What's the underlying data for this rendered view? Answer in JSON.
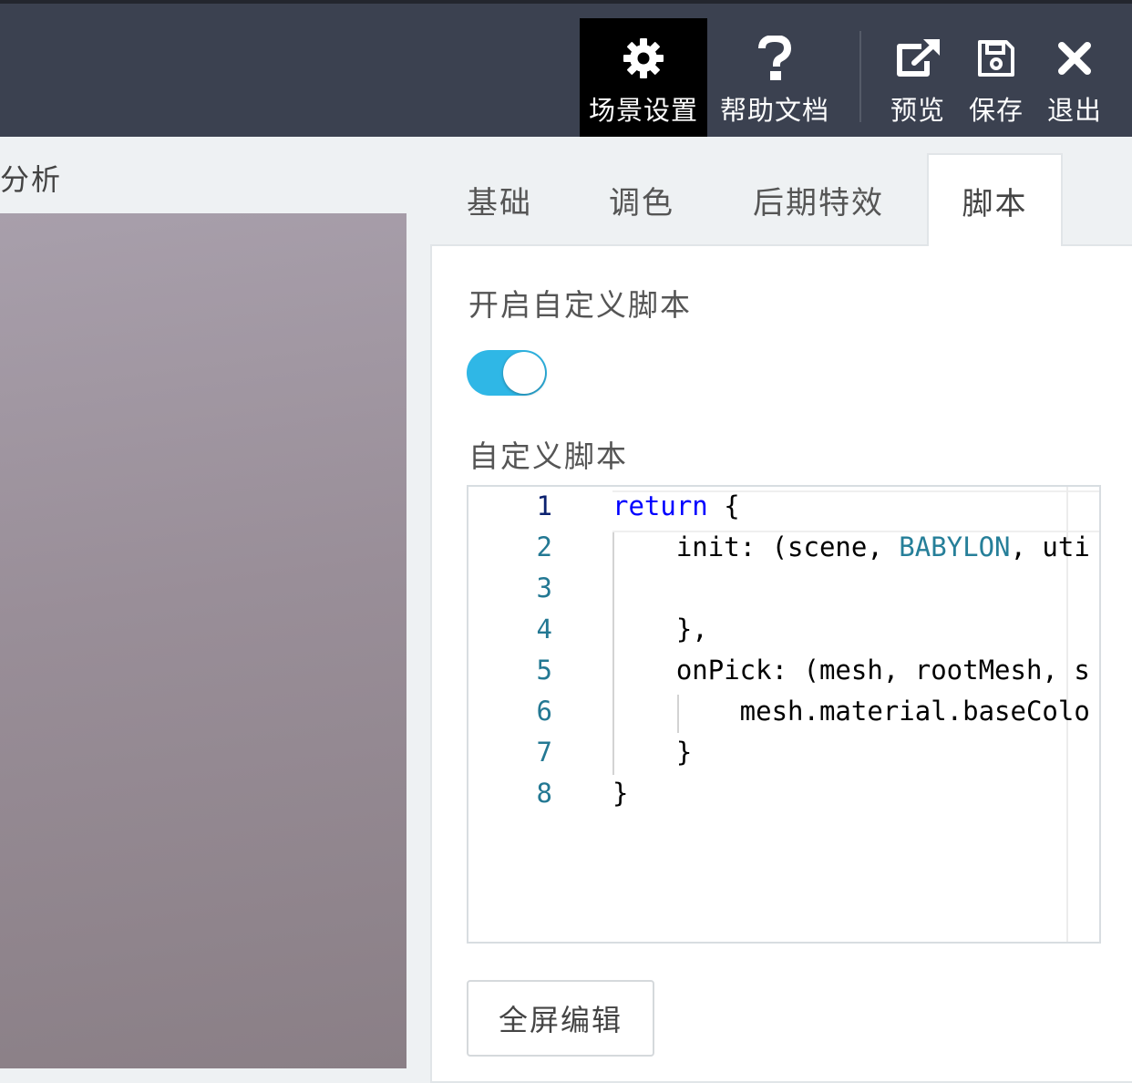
{
  "toolbar": {
    "scene_settings": "场景设置",
    "help_docs": "帮助文档",
    "preview": "预览",
    "save": "保存",
    "exit": "退出"
  },
  "left": {
    "label": "分析"
  },
  "tabs": [
    {
      "label": "基础"
    },
    {
      "label": "调色"
    },
    {
      "label": "后期特效"
    },
    {
      "label": "脚本",
      "active": true
    }
  ],
  "panel": {
    "enable_label": "开启自定义脚本",
    "toggle_on": true,
    "script_label": "自定义脚本",
    "fullscreen_button": "全屏编辑"
  },
  "editor": {
    "line_numbers": [
      "1",
      "2",
      "3",
      "4",
      "5",
      "6",
      "7",
      "8"
    ],
    "lines": {
      "l1_kw": "return",
      "l1_rest": " {",
      "l2_a": "    init: (scene, ",
      "l2_type": "BABYLON",
      "l2_b": ", uti",
      "l3": "",
      "l4": "    },",
      "l5": "    onPick: (mesh, rootMesh, s",
      "l6": "        mesh.material.baseColo",
      "l7": "    }",
      "l8": "}"
    }
  },
  "colors": {
    "topbar": "#3b4150",
    "active_tool": "#000000",
    "toggle_on": "#2fb7e6",
    "line_number": "#237893",
    "keyword": "#0000ff",
    "type": "#267f99"
  }
}
